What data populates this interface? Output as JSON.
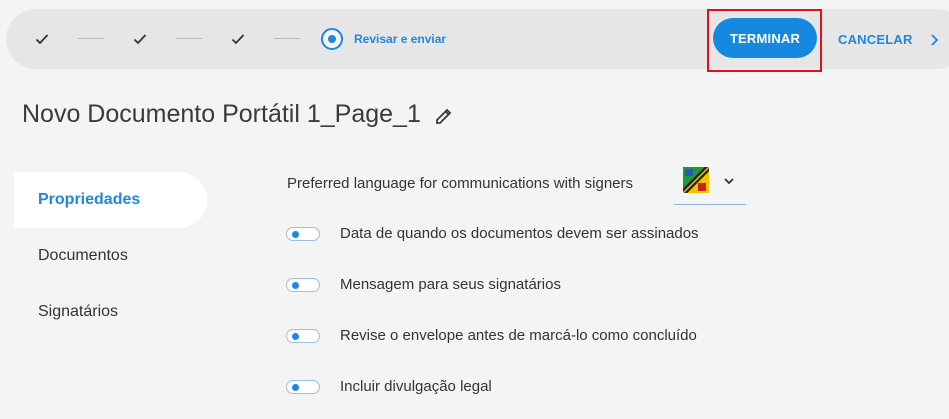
{
  "stepper": {
    "completed_steps": 3,
    "current_step_label": "Revisar e enviar"
  },
  "actions": {
    "finish_label": "TERMINAR",
    "cancel_label": "CANCELAR"
  },
  "document": {
    "title": "Novo Documento Portátil 1_Page_1"
  },
  "sidebar": {
    "items": [
      {
        "label": "Propriedades",
        "active": true
      },
      {
        "label": "Documentos",
        "active": false
      },
      {
        "label": "Signatários",
        "active": false
      }
    ]
  },
  "properties": {
    "language_label": "Preferred language for communications with signers",
    "toggles": [
      {
        "label": "Data de quando os documentos devem ser assinados",
        "on": false
      },
      {
        "label": "Mensagem para seus signatários",
        "on": false
      },
      {
        "label": "Revise o envelope antes de marcá-lo como concluído",
        "on": false
      },
      {
        "label": "Incluir divulgação legal",
        "on": false
      }
    ]
  },
  "colors": {
    "accent": "#1f87dc",
    "button_bg": "#1788e0",
    "highlight": "#e0101a",
    "background": "#f4f4f4"
  }
}
